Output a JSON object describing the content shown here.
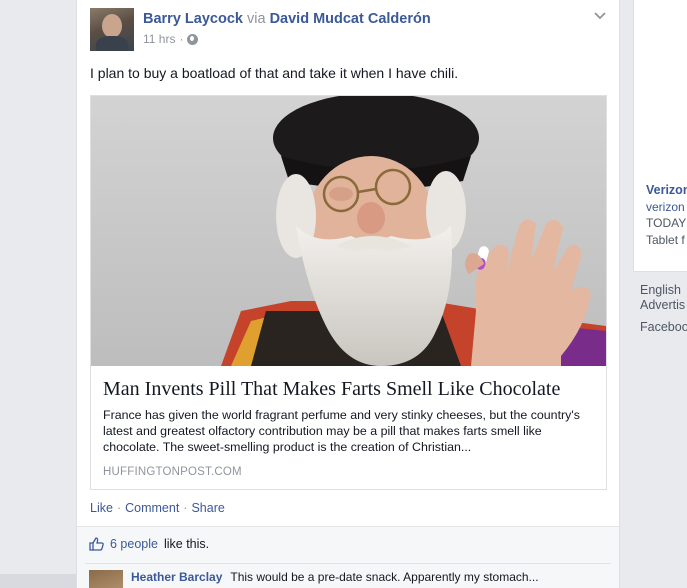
{
  "post": {
    "author": "Barry Laycock",
    "via_word": "via",
    "via_author": "David Mudcat Calderón",
    "time": "11 hrs",
    "separator": "·",
    "message": "I plan to buy a boatload of that and take it when I have chili.",
    "share": {
      "title": "Man Invents Pill That Makes Farts Smell Like Chocolate",
      "description": "France has given the world fragrant perfume and very stinky cheeses, but the country's latest and greatest olfactory contribution may be a pill that makes farts smell like chocolate. The sweet-smelling product is the creation of Christian...",
      "source": "HUFFINGTONPOST.COM"
    },
    "actions": {
      "like": "Like",
      "comment": "Comment",
      "share": "Share",
      "sep": "·"
    },
    "likes": {
      "count_text": "6 people",
      "suffix": "like this."
    },
    "comment": {
      "author": "Heather Barclay",
      "text": "This would be a pre-date snack. Apparently my stomach..."
    }
  },
  "sidebar": {
    "ad": {
      "title": "Verizon",
      "domain": "verizon",
      "line1": "TODAY",
      "line2": "Tablet f"
    },
    "footer": {
      "language": "English",
      "advertising": "Advertis",
      "facebook": "Faceboo"
    }
  },
  "colors": {
    "link": "#3b5998",
    "muted": "#90949c",
    "background": "#e9eaed"
  },
  "icons": [
    "globe-icon",
    "chevron-down-icon",
    "thumbs-up-icon"
  ]
}
